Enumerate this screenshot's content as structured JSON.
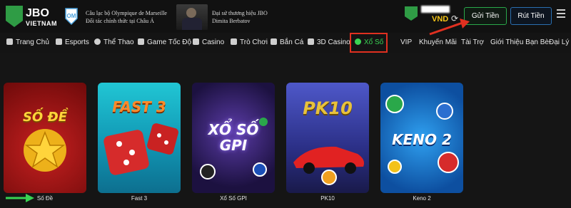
{
  "brand": {
    "name": "JBO",
    "sub": "VIETNAM"
  },
  "partners": {
    "marseille_line1": "Câu lạc bộ Olympique de Marseille",
    "marseille_line2": "Đối tác chính thức tại Châu Á",
    "ambassador_line1": "Đại sứ thương hiệu JBO",
    "ambassador_line2": "Dimita Berbatov"
  },
  "account": {
    "currency": "VND"
  },
  "buttons": {
    "deposit": "Gửi Tiền",
    "withdraw": "Rút Tiền"
  },
  "nav": [
    {
      "label": "Trang Chủ",
      "icon": "home-icon"
    },
    {
      "label": "Esports",
      "icon": "esports-icon"
    },
    {
      "label": "Thể Thao",
      "icon": "soccer-ball-icon"
    },
    {
      "label": "Game Tốc Độ",
      "icon": "gamepad-icon"
    },
    {
      "label": "Casino",
      "icon": "cards-icon"
    },
    {
      "label": "Trò Chơi",
      "icon": "slot-icon"
    },
    {
      "label": "Bắn Cá",
      "icon": "fish-icon"
    },
    {
      "label": "3D Casino",
      "icon": "3d-icon"
    },
    {
      "label": "Xổ Số",
      "icon": "lottery-ball-icon",
      "active": true
    },
    {
      "label": "VIP"
    },
    {
      "label": "Khuyến Mãi"
    },
    {
      "label": "Tài Trợ"
    },
    {
      "label": "Giới Thiệu Bạn Bè"
    },
    {
      "label": "Đại Lý"
    }
  ],
  "games": [
    {
      "caption": "Số Đề",
      "logo": "SỐ ĐỀ",
      "bg": "#8e1111"
    },
    {
      "caption": "Fast 3",
      "logo": "FAST 3",
      "bg": "#15b5c2"
    },
    {
      "caption": "Xổ Số GPI",
      "logo": "XỔ SỐ GPI",
      "bg": "#2a1d55"
    },
    {
      "caption": "PK10",
      "logo": "PK10",
      "bg": "#3a3fa8"
    },
    {
      "caption": "Keno 2",
      "logo": "KENO 2",
      "bg": "#1a7fd0"
    }
  ],
  "colors": {
    "accent_green": "#39d353",
    "highlight_red": "#e03020",
    "currency_gold": "#f5c518"
  }
}
